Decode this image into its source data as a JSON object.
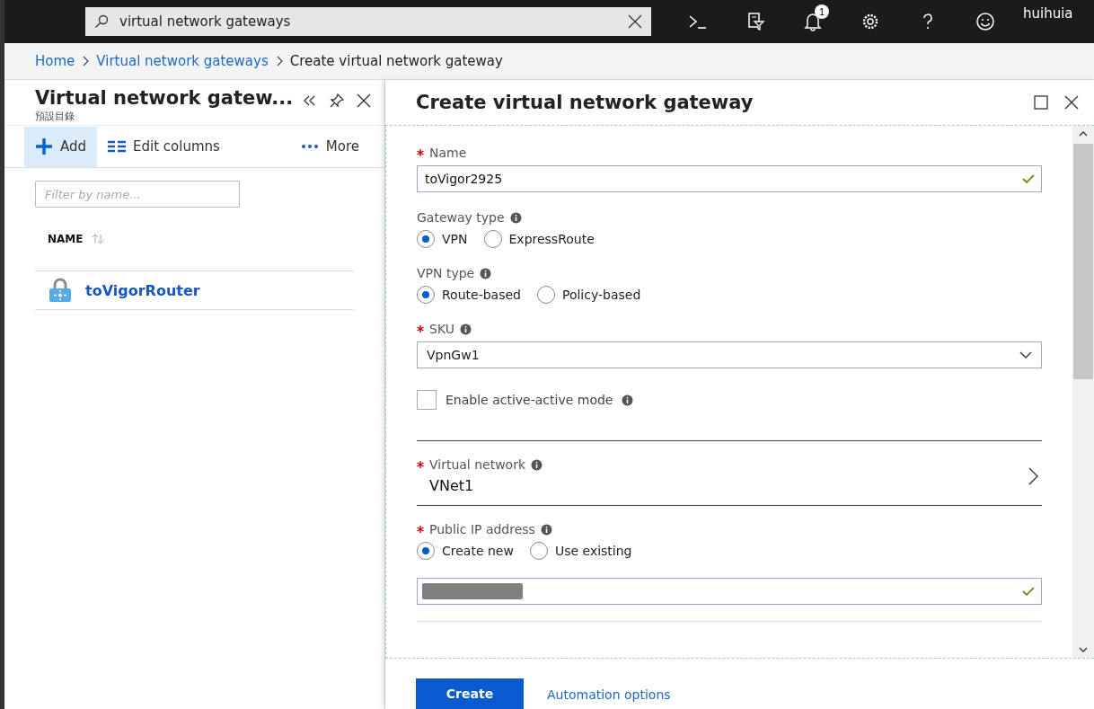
{
  "top_bar": {
    "search": {
      "value": "virtual network gateways"
    },
    "notification_count": "1",
    "user": "huihuia"
  },
  "breadcrumb": [
    "Home",
    "Virtual network gateways",
    "Create virtual network gateway"
  ],
  "left_blade": {
    "title": "Virtual network gatew...",
    "subtitle": "預設目錄",
    "toolbar": [
      {
        "kind": "add",
        "label": "Add",
        "selected": true
      },
      {
        "kind": "columns",
        "label": "Edit columns",
        "selected": false
      },
      {
        "kind": "more",
        "label": "More",
        "selected": false
      }
    ],
    "filter": {
      "placeholder": "Filter by name..."
    },
    "table": {
      "columns": [
        "NAME"
      ],
      "rows": [
        {
          "name": "toVigorRouter"
        }
      ]
    }
  },
  "right_blade": {
    "title": "Create virtual network gateway",
    "fields": [
      {
        "kind": "text",
        "label": "Name",
        "required": true,
        "info": false,
        "value": "toVigor2925",
        "valid": true
      },
      {
        "kind": "radio",
        "label": "Gateway type",
        "required": false,
        "info": true,
        "options": [
          {
            "label": "VPN",
            "selected": true
          },
          {
            "label": "ExpressRoute",
            "selected": false
          }
        ]
      },
      {
        "kind": "radio",
        "label": "VPN type",
        "required": false,
        "info": true,
        "options": [
          {
            "label": "Route-based",
            "selected": true
          },
          {
            "label": "Policy-based",
            "selected": false
          }
        ]
      },
      {
        "kind": "select",
        "label": "SKU",
        "required": true,
        "info": true,
        "value": "VpnGw1"
      },
      {
        "kind": "checkbox",
        "label": "Enable active-active mode",
        "info": true,
        "checked": false
      },
      {
        "kind": "picker",
        "label": "Virtual network",
        "required": true,
        "info": true,
        "value": "VNet1"
      },
      {
        "kind": "radio",
        "label": "Public IP address",
        "required": true,
        "info": true,
        "options": [
          {
            "label": "Create new",
            "selected": true
          },
          {
            "label": "Use existing",
            "selected": false
          }
        ]
      },
      {
        "kind": "redacted_text",
        "valid": true
      }
    ],
    "footer": {
      "primary": "Create",
      "link": "Automation options"
    }
  }
}
